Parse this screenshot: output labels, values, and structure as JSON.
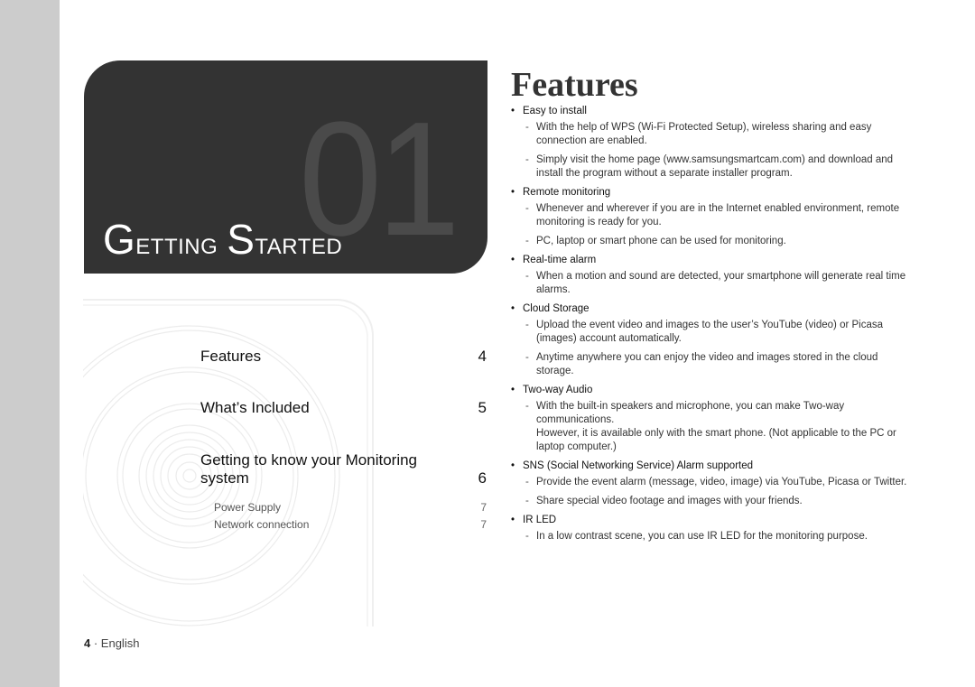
{
  "chapter": {
    "number": "01",
    "title_first_initial": "G",
    "title_first_rest": "etting",
    "title_second_initial": "S",
    "title_second_rest": "tarted"
  },
  "toc": {
    "entries": [
      {
        "label": "Features",
        "page": "4"
      },
      {
        "label": "What’s Included",
        "page": "5"
      },
      {
        "label_line1": "Getting to know your Monitoring",
        "label_line2": "system",
        "page": "6"
      }
    ],
    "sub_entries": [
      {
        "label": "Power Supply",
        "page": "7"
      },
      {
        "label": "Network connection",
        "page": "7"
      }
    ]
  },
  "footer": {
    "page_number": "4",
    "separator": " · ",
    "language": "English"
  },
  "features": {
    "title": "Features",
    "bullet_glyph": "•",
    "dash_glyph": "-",
    "items": [
      {
        "heading": "Easy to install",
        "points": [
          "With the help of WPS (Wi-Fi Protected Setup), wireless sharing and easy connection are enabled.",
          "Simply visit the home page (www.samsungsmartcam.com) and download and install the program without a separate installer program."
        ]
      },
      {
        "heading": "Remote monitoring",
        "points": [
          "Whenever and wherever if you are in the Internet enabled environment, remote monitoring is ready for you.",
          "PC, laptop or smart phone can be used for monitoring."
        ]
      },
      {
        "heading": "Real-time alarm",
        "points": [
          "When a motion and sound are detected, your smartphone will generate real time alarms."
        ]
      },
      {
        "heading": "Cloud Storage",
        "points": [
          "Upload the event video and images to the user’s YouTube (video) or Picasa (images) account automatically.",
          "Anytime anywhere you can enjoy the video and images stored in the cloud storage."
        ]
      },
      {
        "heading": "Two-way Audio",
        "points": [
          "With the built-in speakers and microphone, you can make Two-way communications.",
          "However, it is available only with the smart phone. (Not applicable to the PC or laptop computer.)"
        ]
      },
      {
        "heading": "SNS (Social Networking Service) Alarm supported",
        "points": [
          "Provide the event alarm (message, video, image) via YouTube, Picasa or Twitter.",
          "Share special video footage and images with your friends."
        ]
      },
      {
        "heading": "IR LED",
        "points": [
          "In a low contrast scene, you can use IR LED for the monitoring purpose."
        ]
      }
    ]
  }
}
